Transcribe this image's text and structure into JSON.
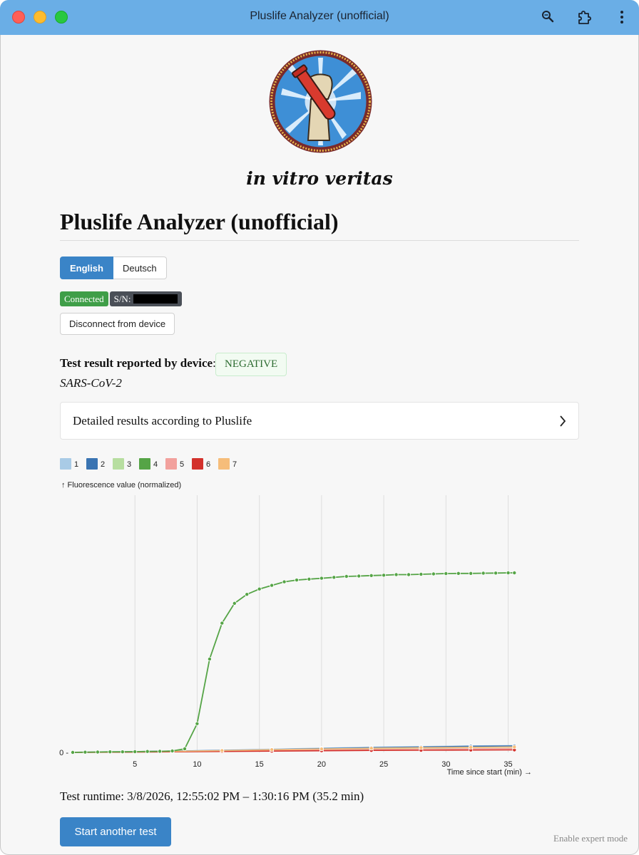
{
  "window": {
    "title": "Pluslife Analyzer (unofficial)"
  },
  "toolbar": {
    "icons": [
      "zoom-icon",
      "extension-icon",
      "more-menu-icon"
    ]
  },
  "logo": {
    "motto": "in vitro veritas"
  },
  "page": {
    "heading": "Pluslife Analyzer (unofficial)"
  },
  "language": {
    "options": [
      "English",
      "Deutsch"
    ],
    "selected": "English"
  },
  "device": {
    "status": "Connected",
    "serial_label": "S/N:",
    "disconnect_label": "Disconnect from device"
  },
  "result": {
    "label": "Test result reported by device",
    "value": "NEGATIVE",
    "pathogen": "SARS-CoV-2"
  },
  "details": {
    "label": "Detailed results according to Pluslife"
  },
  "chart_data": {
    "type": "line",
    "ylabel": "↑ Fluorescence value (normalized)",
    "xlabel": "Time since start (min) →",
    "xlim": [
      0,
      36
    ],
    "x_ticks": [
      "5",
      "10",
      "15",
      "20",
      "25",
      "30",
      "35"
    ],
    "y_ticks": [
      "0"
    ],
    "grid": "vertical",
    "legend": "top-left",
    "series": [
      {
        "name": "1",
        "color": "#a9cbe6",
        "x": [
          0,
          4,
          8,
          12,
          16,
          20,
          24,
          28,
          32,
          35.5
        ],
        "y": [
          0,
          0.003,
          0.007,
          0.012,
          0.018,
          0.024,
          0.029,
          0.032,
          0.036,
          0.038
        ]
      },
      {
        "name": "2",
        "color": "#3a74b2",
        "x": [
          0,
          4,
          8,
          12,
          16,
          20,
          24,
          28,
          32,
          35.5
        ],
        "y": [
          0,
          0.003,
          0.007,
          0.011,
          0.016,
          0.021,
          0.026,
          0.03,
          0.034,
          0.036
        ]
      },
      {
        "name": "3",
        "color": "#b7dea0",
        "x": [
          0,
          4,
          8,
          12,
          16,
          20,
          24,
          28,
          32,
          35.5
        ],
        "y": [
          0,
          0.002,
          0.005,
          0.009,
          0.013,
          0.017,
          0.021,
          0.024,
          0.027,
          0.029
        ]
      },
      {
        "name": "4",
        "color": "#55a446",
        "x": [
          0,
          1,
          2,
          3,
          4,
          5,
          6,
          7,
          8,
          9,
          10,
          11,
          12,
          13,
          14,
          15,
          16,
          17,
          18,
          19,
          20,
          21,
          22,
          23,
          24,
          25,
          26,
          27,
          28,
          29,
          30,
          31,
          32,
          33,
          34,
          35,
          35.5
        ],
        "y": [
          0,
          0.001,
          0.002,
          0.003,
          0.003,
          0.004,
          0.005,
          0.006,
          0.008,
          0.02,
          0.16,
          0.52,
          0.72,
          0.83,
          0.88,
          0.91,
          0.93,
          0.95,
          0.96,
          0.965,
          0.97,
          0.975,
          0.98,
          0.982,
          0.985,
          0.987,
          0.99,
          0.99,
          0.992,
          0.994,
          0.996,
          0.997,
          0.997,
          0.998,
          0.999,
          1.0,
          1.0
        ]
      },
      {
        "name": "5",
        "color": "#f2a19d",
        "x": [
          0,
          4,
          8,
          12,
          16,
          20,
          24,
          28,
          32,
          35.5
        ],
        "y": [
          0,
          0.002,
          0.004,
          0.007,
          0.01,
          0.013,
          0.016,
          0.018,
          0.02,
          0.021
        ]
      },
      {
        "name": "6",
        "color": "#d3312c",
        "x": [
          0,
          4,
          8,
          12,
          16,
          20,
          24,
          28,
          32,
          35.5
        ],
        "y": [
          0,
          0.001,
          0.003,
          0.005,
          0.007,
          0.009,
          0.011,
          0.012,
          0.013,
          0.014
        ]
      },
      {
        "name": "7",
        "color": "#f6bd7a",
        "x": [
          0,
          4,
          8,
          12,
          16,
          20,
          24,
          28,
          32,
          35.5
        ],
        "y": [
          0,
          0.003,
          0.006,
          0.01,
          0.015,
          0.019,
          0.023,
          0.026,
          0.028,
          0.03
        ]
      }
    ]
  },
  "runtime": {
    "text": "Test runtime: 3/8/2026, 12:55:02 PM – 1:30:16 PM (35.2 min)"
  },
  "actions": {
    "start_label": "Start another test",
    "expert_label": "Enable expert mode"
  }
}
